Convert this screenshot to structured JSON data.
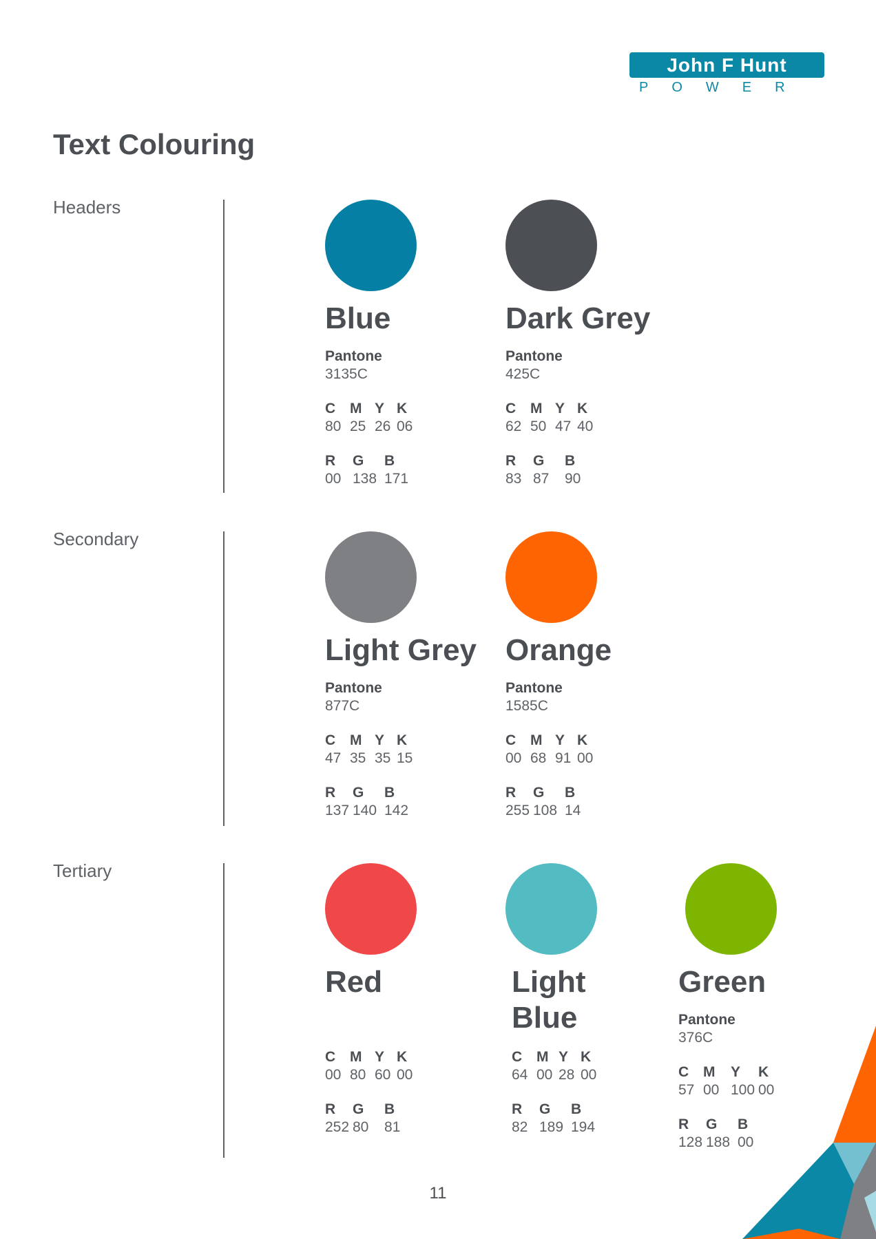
{
  "logo": {
    "name": "John F Hunt",
    "sub": "POWER"
  },
  "title": "Text Colouring",
  "sections": [
    {
      "label": "Headers",
      "swatches": [
        {
          "name": "Blue",
          "color": "#0580a4",
          "pantone_label": "Pantone",
          "pantone": "3135C",
          "cmyk_labels": [
            "C",
            "M",
            "Y",
            "K"
          ],
          "cmyk": [
            "80",
            "25",
            "26",
            "06"
          ],
          "rgb_labels": [
            "R",
            "G",
            "B"
          ],
          "rgb": [
            "00",
            "138",
            "171"
          ]
        },
        {
          "name": "Dark Grey",
          "color": "#4c4f53",
          "pantone_label": "Pantone",
          "pantone": "425C",
          "cmyk_labels": [
            "C",
            "M",
            "Y",
            "K"
          ],
          "cmyk": [
            "62",
            "50",
            "47",
            "40"
          ],
          "rgb_labels": [
            "R",
            "G",
            "B"
          ],
          "rgb": [
            "83",
            "87",
            "90"
          ]
        }
      ]
    },
    {
      "label": "Secondary",
      "swatches": [
        {
          "name": "Light Grey",
          "color": "#7f8083",
          "pantone_label": "Pantone",
          "pantone": "877C",
          "cmyk_labels": [
            "C",
            "M",
            "Y",
            "K"
          ],
          "cmyk": [
            "47",
            "35",
            "35",
            "15"
          ],
          "rgb_labels": [
            "R",
            "G",
            "B"
          ],
          "rgb": [
            "137",
            "140",
            "142"
          ]
        },
        {
          "name": "Orange",
          "color": "#fe6402",
          "pantone_label": "Pantone",
          "pantone": "1585C",
          "cmyk_labels": [
            "C",
            "M",
            "Y",
            "K"
          ],
          "cmyk": [
            "00",
            "68",
            "91",
            "00"
          ],
          "rgb_labels": [
            "R",
            "G",
            "B"
          ],
          "rgb": [
            "255",
            "108",
            "14"
          ]
        }
      ]
    },
    {
      "label": "Tertiary",
      "swatches": [
        {
          "name": "Red",
          "color": "#f04848",
          "cmyk_labels": [
            "C",
            "M",
            "Y",
            "K"
          ],
          "cmyk": [
            "00",
            "80",
            "60",
            "00"
          ],
          "rgb_labels": [
            "R",
            "G",
            "B"
          ],
          "rgb": [
            "252",
            "80",
            "81"
          ]
        },
        {
          "name": "Light Blue",
          "color": "#52bcc2",
          "cmyk_labels": [
            "C",
            "M",
            "Y",
            "K"
          ],
          "cmyk": [
            "64",
            "00",
            "28",
            "00"
          ],
          "rgb_labels": [
            "R",
            "G",
            "B"
          ],
          "rgb": [
            "82",
            "189",
            "194"
          ]
        },
        {
          "name": "Green",
          "color": "#7eb501",
          "pantone_label": "Pantone",
          "pantone": "376C",
          "cmyk_labels": [
            "C",
            "M",
            "Y",
            "K"
          ],
          "cmyk": [
            "57",
            "00",
            "100",
            "00"
          ],
          "rgb_labels": [
            "R",
            "G",
            "B"
          ],
          "rgb": [
            "128",
            "188",
            "00"
          ]
        }
      ]
    }
  ],
  "page_number": "11",
  "corner_colors": {
    "orange": "#fe6402",
    "blue": "#0a88a6",
    "light_blue": "#74bfd0",
    "grey": "#7f8083",
    "pale_blue": "#a6dbe6"
  }
}
